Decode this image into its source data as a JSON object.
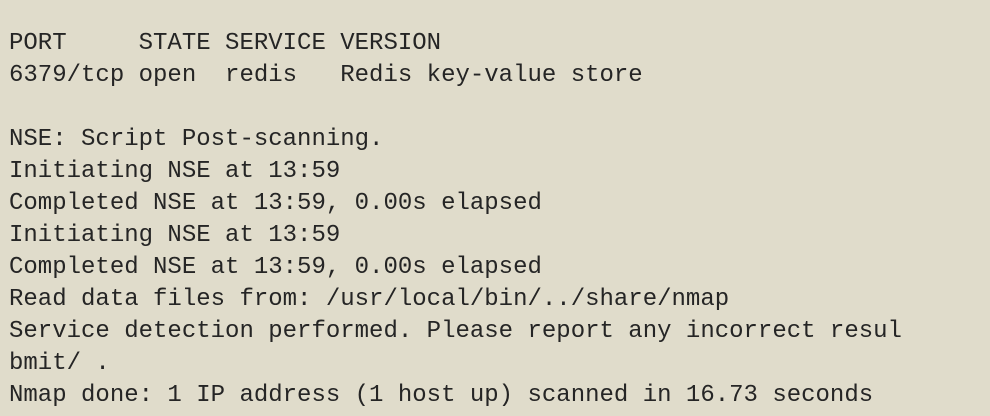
{
  "terminal": {
    "lines": [
      "PORT     STATE SERVICE VERSION",
      "6379/tcp open  redis   Redis key-value store",
      "",
      "NSE: Script Post-scanning.",
      "Initiating NSE at 13:59",
      "Completed NSE at 13:59, 0.00s elapsed",
      "Initiating NSE at 13:59",
      "Completed NSE at 13:59, 0.00s elapsed",
      "Read data files from: /usr/local/bin/../share/nmap",
      "Service detection performed. Please report any incorrect resul",
      "bmit/ .",
      "Nmap done: 1 IP address (1 host up) scanned in 16.73 seconds"
    ]
  },
  "colors": {
    "background": "#e0dccb",
    "text": "#252525"
  }
}
